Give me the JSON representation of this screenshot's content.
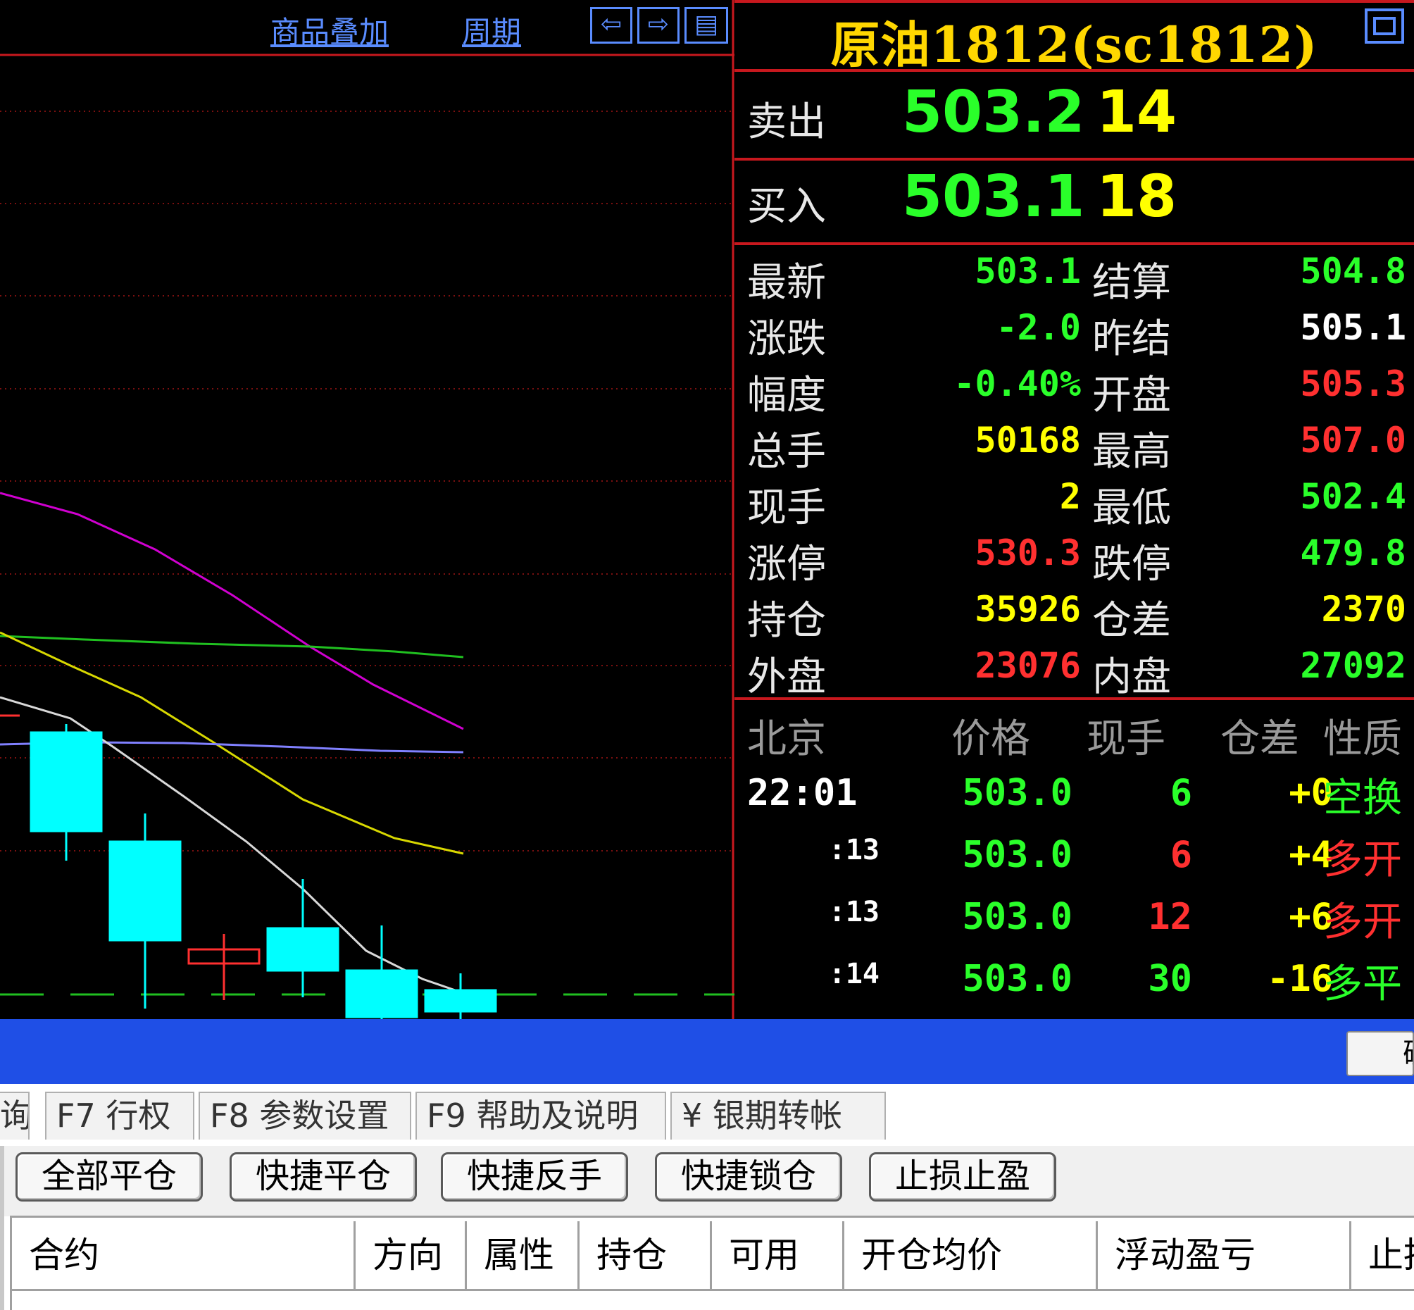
{
  "chart_toolbar": {
    "overlay_label": "商品叠加",
    "period_label": "周期"
  },
  "quote": {
    "title": "原油1812(sc1812)",
    "ask": {
      "label": "卖出",
      "price": "503.2",
      "volume": "14"
    },
    "bid": {
      "label": "买入",
      "price": "503.1",
      "volume": "18"
    },
    "stats": [
      {
        "l1": "最新",
        "v1": "503.1",
        "c1": "g",
        "l2": "结算",
        "v2": "504.8",
        "c2": "g"
      },
      {
        "l1": "涨跌",
        "v1": "-2.0",
        "c1": "g",
        "l2": "昨结",
        "v2": "505.1",
        "c2": "w"
      },
      {
        "l1": "幅度",
        "v1": "-0.40%",
        "c1": "g",
        "l2": "开盘",
        "v2": "505.3",
        "c2": "r"
      },
      {
        "l1": "总手",
        "v1": "50168",
        "c1": "y",
        "l2": "最高",
        "v2": "507.0",
        "c2": "r"
      },
      {
        "l1": "现手",
        "v1": "2",
        "c1": "y",
        "l2": "最低",
        "v2": "502.4",
        "c2": "g"
      },
      {
        "l1": "涨停",
        "v1": "530.3",
        "c1": "r",
        "l2": "跌停",
        "v2": "479.8",
        "c2": "g"
      },
      {
        "l1": "持仓",
        "v1": "35926",
        "c1": "y",
        "l2": "仓差",
        "v2": "2370",
        "c2": "y"
      },
      {
        "l1": "外盘",
        "v1": "23076",
        "c1": "r",
        "l2": "内盘",
        "v2": "27092",
        "c2": "g"
      }
    ],
    "ticks_header": [
      "北京",
      "价格",
      "现手",
      "仓差",
      "性质"
    ],
    "ticks": [
      {
        "time": "22:01",
        "price": "503.0",
        "vol": "6",
        "vol_c": "g",
        "oi": "+0",
        "nature": "空换",
        "nat_c": "g"
      },
      {
        "time": ":13",
        "price": "503.0",
        "vol": "6",
        "vol_c": "r",
        "oi": "+4",
        "nature": "多开",
        "nat_c": "r"
      },
      {
        "time": ":13",
        "price": "503.0",
        "vol": "12",
        "vol_c": "r",
        "oi": "+6",
        "nature": "多开",
        "nat_c": "r"
      },
      {
        "time": ":14",
        "price": "503.0",
        "vol": "30",
        "vol_c": "g",
        "oi": "-16",
        "nature": "多平",
        "nat_c": "g"
      }
    ]
  },
  "tabs": [
    "询",
    "F7 行权",
    "F8 参数设置",
    "F9 帮助及说明",
    "¥ 银期转帐"
  ],
  "actions": [
    "全部平仓",
    "快捷平仓",
    "快捷反手",
    "快捷锁仓",
    "止损止盈"
  ],
  "table_headers": [
    "合约",
    "方向",
    "属性",
    "持仓",
    "可用",
    "开仓均价",
    "浮动盈亏",
    "止损"
  ],
  "bluebar_button": "确",
  "colors": {
    "up": "#ff3030",
    "down": "#00ffff",
    "ma_white": "#d8d8d8",
    "ma_yellow": "#d8d800",
    "ma_magenta": "#d000d0",
    "ma_green": "#20c020",
    "ma_violet": "#8080ff"
  }
}
